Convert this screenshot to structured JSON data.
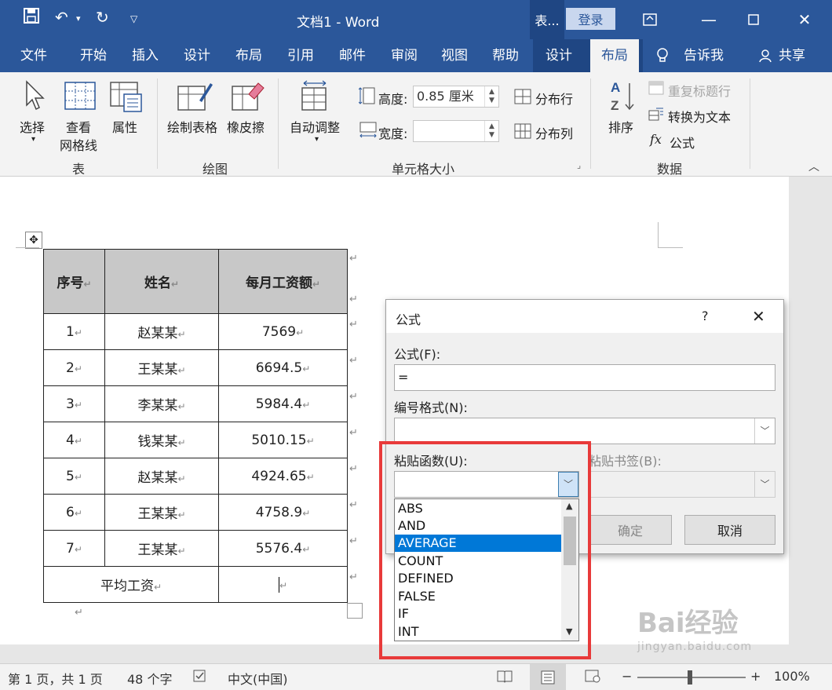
{
  "titlebar": {
    "doc_title": "文档1  -  Word",
    "context_tab_short": "表...",
    "login": "登录"
  },
  "tabs": [
    "文件",
    "开始",
    "插入",
    "设计",
    "布局",
    "引用",
    "邮件",
    "审阅",
    "视图",
    "帮助",
    "设计",
    "布局"
  ],
  "tell_me": "告诉我",
  "share": "共享",
  "ribbon": {
    "table_group": {
      "label": "表",
      "select": "选择",
      "view_grid_1": "查看",
      "view_grid_2": "网格线",
      "properties": "属性"
    },
    "draw_group": {
      "label": "绘图",
      "draw_table": "绘制表格",
      "eraser": "橡皮擦"
    },
    "cell_size_group": {
      "label": "单元格大小",
      "autofit": "自动调整",
      "height_label": "高度:",
      "height_value": "0.85 厘米",
      "width_label": "宽度:",
      "width_value": "",
      "distribute_rows": "分布行",
      "distribute_cols": "分布列"
    },
    "data_group": {
      "label": "数据",
      "sort": "排序",
      "repeat_header": "重复标题行",
      "convert_text": "转换为文本",
      "formula": "公式",
      "formula_icon": "fx"
    }
  },
  "table": {
    "headers": [
      "序号",
      "姓名",
      "每月工资额"
    ],
    "rows": [
      [
        "1",
        "赵某某",
        "7569"
      ],
      [
        "2",
        "王某某",
        "6694.5"
      ],
      [
        "3",
        "李某某",
        "5984.4"
      ],
      [
        "4",
        "钱某某",
        "5010.15"
      ],
      [
        "5",
        "赵某某",
        "4924.65"
      ],
      [
        "6",
        "王某某",
        "4758.9"
      ],
      [
        "7",
        "王某某",
        "5576.4"
      ]
    ],
    "footer_label": "平均工资",
    "mark": "↵"
  },
  "dialog": {
    "title": "公式",
    "help": "?",
    "formula_label": "公式(F):",
    "formula_value": "=",
    "number_format_label": "编号格式(N):",
    "paste_function_label": "粘贴函数(U):",
    "paste_bookmark_label": "粘贴书签(B):",
    "ok": "确定",
    "cancel": "取消"
  },
  "function_list": {
    "items": [
      "ABS",
      "AND",
      "AVERAGE",
      "COUNT",
      "DEFINED",
      "FALSE",
      "IF",
      "INT"
    ],
    "selected": "AVERAGE"
  },
  "status": {
    "page": "第 1 页，共 1 页",
    "words": "48 个字",
    "language": "中文(中国)",
    "zoom_percent": "100%",
    "zoom_minus": "−",
    "zoom_plus": "+"
  },
  "watermark": {
    "brand": "Bai经验",
    "url": "jingyan.baidu.com"
  },
  "colors": {
    "word_blue": "#2b579a",
    "context_dark": "#1f4683",
    "selection": "#0078d7",
    "highlight_red": "#e83a3a"
  }
}
